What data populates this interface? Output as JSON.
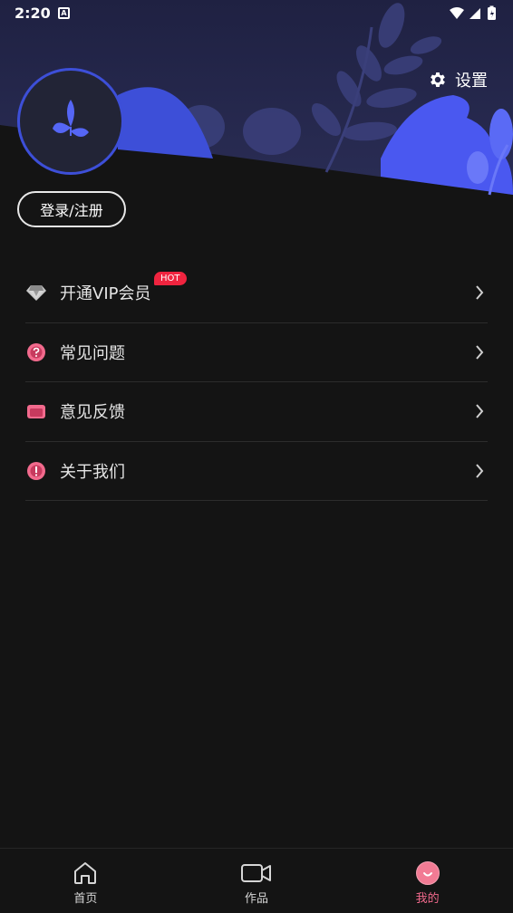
{
  "status_bar": {
    "time": "2:20",
    "notification_icon": "A"
  },
  "header": {
    "settings_label": "设置",
    "login_label": "登录/注册"
  },
  "menu": {
    "items": [
      {
        "label": "开通VIP会员",
        "icon": "diamond-icon",
        "badge": "HOT"
      },
      {
        "label": "常见问题",
        "icon": "question-icon"
      },
      {
        "label": "意见反馈",
        "icon": "feedback-icon"
      },
      {
        "label": "关于我们",
        "icon": "info-icon"
      }
    ]
  },
  "tabbar": {
    "tabs": [
      {
        "label": "首页",
        "icon": "home-icon",
        "active": false
      },
      {
        "label": "作品",
        "icon": "video-camera-icon",
        "active": false
      },
      {
        "label": "我的",
        "icon": "profile-face-icon",
        "active": true
      }
    ]
  },
  "colors": {
    "background": "#141414",
    "header_gradient_top": "#1f2040",
    "accent_blue": "#4e5cf0",
    "accent_pink": "#f26a8d",
    "hot_badge": "#f0243f"
  }
}
